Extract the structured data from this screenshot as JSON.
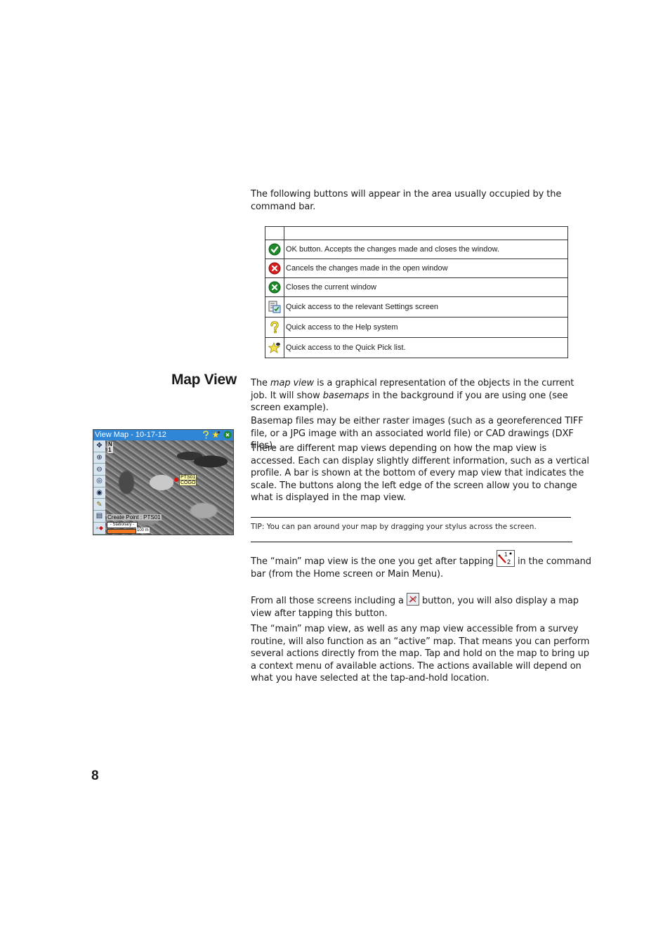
{
  "intro": "The following buttons will appear in the area usually occupied by the command bar.",
  "button_table": {
    "header": [
      "",
      ""
    ],
    "rows": [
      {
        "icon": "ok-check-icon",
        "description": "OK button. Accepts the changes made and closes the window."
      },
      {
        "icon": "cancel-x-icon",
        "description": "Cancels the changes made in the open window"
      },
      {
        "icon": "close-x-icon",
        "description": "Closes the current window"
      },
      {
        "icon": "settings-icon",
        "description": "Quick access to the relevant Settings screen"
      },
      {
        "icon": "help-question-icon",
        "description": "Quick access to the Help system"
      },
      {
        "icon": "quick-pick-star-icon",
        "description": "Quick access to the Quick Pick list."
      }
    ]
  },
  "section": {
    "heading": "Map View",
    "p1_a": "The ",
    "p1_em1": "map view",
    "p1_b": " is a graphical representation of the objects in the current job. It will show ",
    "p1_em2": "basemaps",
    "p1_c": " in the background if you are using one (see screen example).",
    "p2": "Basemap files may be either raster images (such as a georeferenced TIFF file, or a JPG image with an associated world file) or CAD drawings (DXF files).",
    "p3": "There are different map views depending on how the map view is accessed. Each can display slightly different information, such as a vertical profile. A bar is shown at the bottom of every map view that indicates the scale. The buttons along the left edge of the screen allow you to change what is displayed in the map view.",
    "tip": "TIP: You can pan around your map by dragging your stylus across the screen.",
    "p4_a": "The “main” map view is the one you get after tapping ",
    "p4_b": " in the command bar (from the Home screen or Main Menu).",
    "p5_a": "From all those screens including a ",
    "p5_b": " button, you will also display a map view after tapping this button.",
    "p6": "The “main” map view, as well as any map view accessible from a survey routine, will also function as an “active” map. That means you can perform several actions directly from the map. Tap and hold on the map to bring up a context menu of available actions. The actions available will depend on what you have selected at the tap-and-hold location."
  },
  "device_screen": {
    "title": "View Map - 10-17-12",
    "north_label": "N",
    "north_num": "1",
    "point_label": "PTS01",
    "point_code": "COGO",
    "create_point": "Create Point : PTS01",
    "mode": "- Stationary -",
    "scale": "100 m",
    "tools": [
      "pan-icon",
      "zoom-in-icon",
      "zoom-out-icon",
      "zoom-window-icon",
      "zoom-extents-icon",
      "edit-icon",
      "layers-icon",
      "more-icon"
    ]
  },
  "page_number": "8"
}
